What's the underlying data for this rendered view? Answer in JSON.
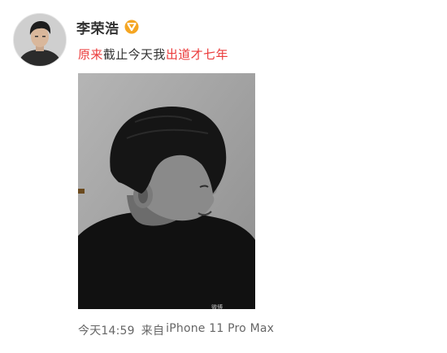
{
  "user": {
    "name": "李荣浩",
    "verified": true,
    "verified_color": "#f5a623"
  },
  "post": {
    "text_parts": [
      {
        "text": "原来",
        "color": "#eb3b3b"
      },
      {
        "text": "截止今天我",
        "color": "#333333"
      },
      {
        "text": "出道",
        "color": "#eb3b3b"
      },
      {
        "text": "才七年",
        "color": "#eb3b3b"
      }
    ],
    "image": {
      "description_icon": "photo-icon",
      "watermark": "微博"
    }
  },
  "meta": {
    "time": "今天14:59",
    "source_prefix": "来自",
    "device": "iPhone 11 Pro Max"
  }
}
